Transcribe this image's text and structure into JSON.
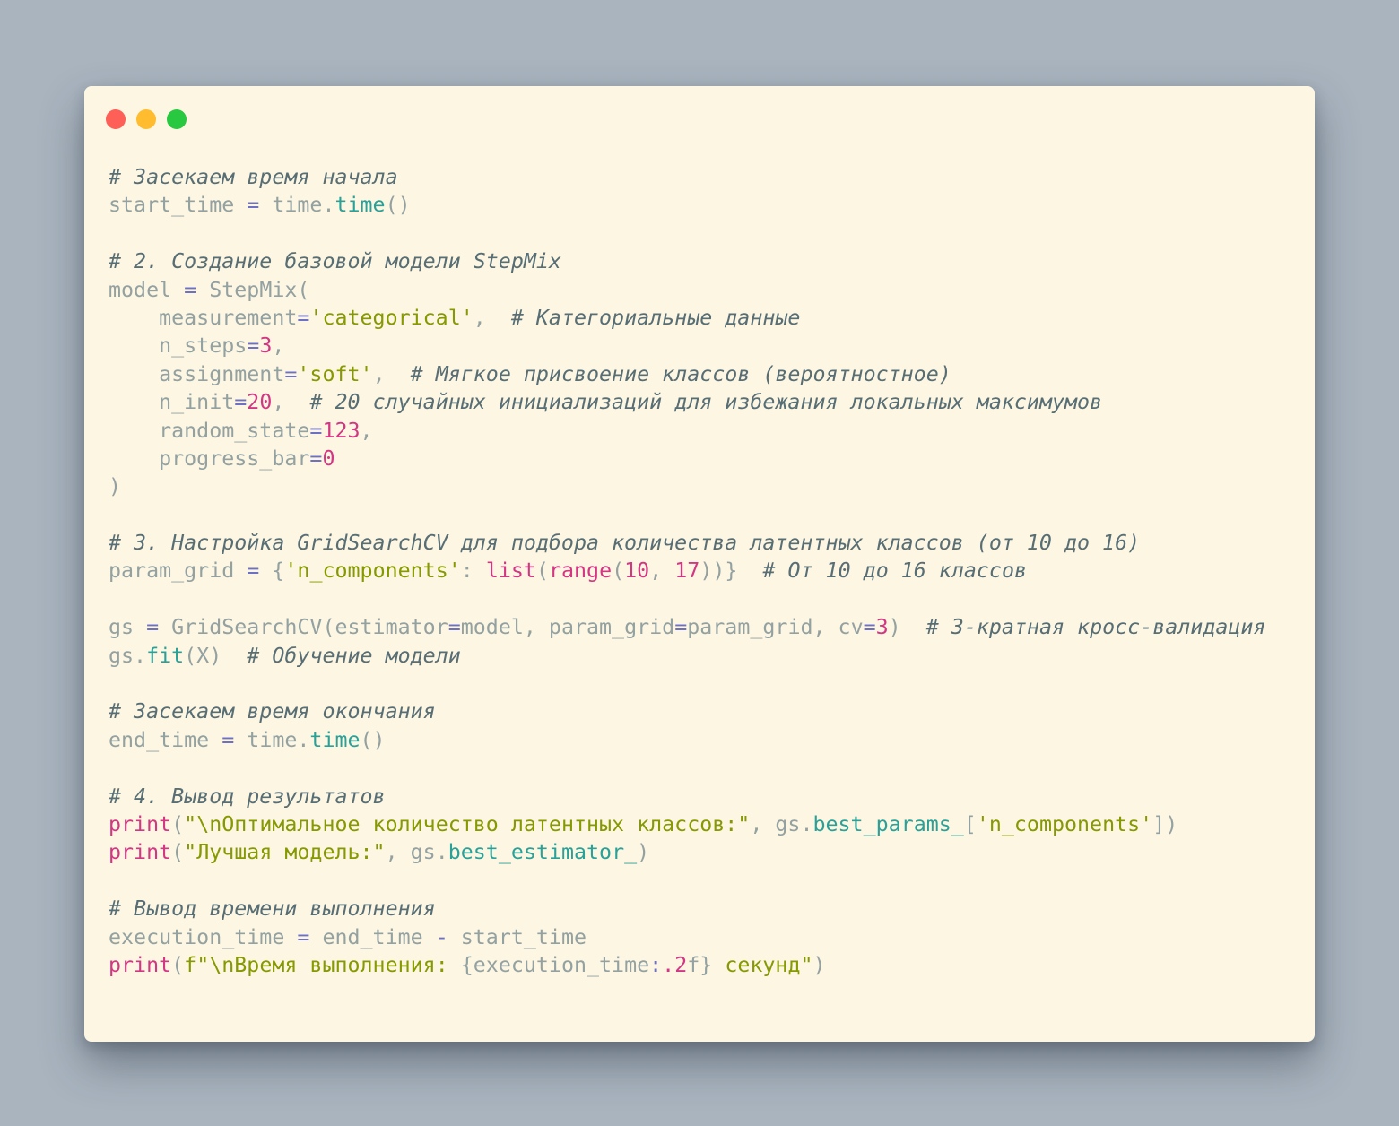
{
  "window": {
    "control_colors": [
      "#fe5f57",
      "#febc2e",
      "#28c840"
    ]
  },
  "code": {
    "lines": [
      [
        {
          "t": "# Засекаем время начала",
          "c": "cm"
        }
      ],
      [
        {
          "t": "start_time ",
          "c": "df"
        },
        {
          "t": "=",
          "c": "op"
        },
        {
          "t": " time.",
          "c": "df"
        },
        {
          "t": "time",
          "c": "fn"
        },
        {
          "t": "()",
          "c": "df"
        }
      ],
      [],
      [
        {
          "t": "# 2. Создание базовой модели StepMix",
          "c": "cm"
        }
      ],
      [
        {
          "t": "model ",
          "c": "df"
        },
        {
          "t": "=",
          "c": "op"
        },
        {
          "t": " StepMix(",
          "c": "df"
        }
      ],
      [
        {
          "t": "    measurement",
          "c": "df"
        },
        {
          "t": "=",
          "c": "op"
        },
        {
          "t": "'categorical'",
          "c": "str"
        },
        {
          "t": ",  ",
          "c": "df"
        },
        {
          "t": "# Категориальные данные",
          "c": "cm"
        }
      ],
      [
        {
          "t": "    n_steps",
          "c": "df"
        },
        {
          "t": "=",
          "c": "op"
        },
        {
          "t": "3",
          "c": "num"
        },
        {
          "t": ",",
          "c": "df"
        }
      ],
      [
        {
          "t": "    assignment",
          "c": "df"
        },
        {
          "t": "=",
          "c": "op"
        },
        {
          "t": "'soft'",
          "c": "str"
        },
        {
          "t": ",  ",
          "c": "df"
        },
        {
          "t": "# Мягкое присвоение классов (вероятностное)",
          "c": "cm"
        }
      ],
      [
        {
          "t": "    n_init",
          "c": "df"
        },
        {
          "t": "=",
          "c": "op"
        },
        {
          "t": "20",
          "c": "num"
        },
        {
          "t": ",  ",
          "c": "df"
        },
        {
          "t": "# 20 случайных инициализаций для избежания локальных максимумов",
          "c": "cm"
        }
      ],
      [
        {
          "t": "    random_state",
          "c": "df"
        },
        {
          "t": "=",
          "c": "op"
        },
        {
          "t": "123",
          "c": "num"
        },
        {
          "t": ",",
          "c": "df"
        }
      ],
      [
        {
          "t": "    progress_bar",
          "c": "df"
        },
        {
          "t": "=",
          "c": "op"
        },
        {
          "t": "0",
          "c": "num"
        }
      ],
      [
        {
          "t": ")",
          "c": "df"
        }
      ],
      [],
      [
        {
          "t": "# 3. Настройка GridSearchCV для подбора количества латентных классов (от 10 до 16)",
          "c": "cm"
        }
      ],
      [
        {
          "t": "param_grid ",
          "c": "df"
        },
        {
          "t": "=",
          "c": "op"
        },
        {
          "t": " {",
          "c": "df"
        },
        {
          "t": "'n_components'",
          "c": "str"
        },
        {
          "t": ": ",
          "c": "df"
        },
        {
          "t": "list",
          "c": "bi"
        },
        {
          "t": "(",
          "c": "df"
        },
        {
          "t": "range",
          "c": "bi"
        },
        {
          "t": "(",
          "c": "df"
        },
        {
          "t": "10",
          "c": "num"
        },
        {
          "t": ", ",
          "c": "df"
        },
        {
          "t": "17",
          "c": "num"
        },
        {
          "t": "))}  ",
          "c": "df"
        },
        {
          "t": "# От 10 до 16 классов",
          "c": "cm"
        }
      ],
      [],
      [
        {
          "t": "gs ",
          "c": "df"
        },
        {
          "t": "=",
          "c": "op"
        },
        {
          "t": " GridSearchCV(estimator",
          "c": "df"
        },
        {
          "t": "=",
          "c": "op"
        },
        {
          "t": "model, param_grid",
          "c": "df"
        },
        {
          "t": "=",
          "c": "op"
        },
        {
          "t": "param_grid, cv",
          "c": "df"
        },
        {
          "t": "=",
          "c": "op"
        },
        {
          "t": "3",
          "c": "num"
        },
        {
          "t": ")  ",
          "c": "df"
        },
        {
          "t": "# 3-кратная кросс-валидация",
          "c": "cm"
        }
      ],
      [
        {
          "t": "gs.",
          "c": "df"
        },
        {
          "t": "fit",
          "c": "fn"
        },
        {
          "t": "(X)  ",
          "c": "df"
        },
        {
          "t": "# Обучение модели",
          "c": "cm"
        }
      ],
      [],
      [
        {
          "t": "# Засекаем время окончания",
          "c": "cm"
        }
      ],
      [
        {
          "t": "end_time ",
          "c": "df"
        },
        {
          "t": "=",
          "c": "op"
        },
        {
          "t": " time.",
          "c": "df"
        },
        {
          "t": "time",
          "c": "fn"
        },
        {
          "t": "()",
          "c": "df"
        }
      ],
      [],
      [
        {
          "t": "# 4. Вывод результатов",
          "c": "cm"
        }
      ],
      [
        {
          "t": "print",
          "c": "bi"
        },
        {
          "t": "(",
          "c": "df"
        },
        {
          "t": "\"\\nОптимальное количество латентных классов:\"",
          "c": "str"
        },
        {
          "t": ", gs.",
          "c": "df"
        },
        {
          "t": "best_params_",
          "c": "fn"
        },
        {
          "t": "[",
          "c": "df"
        },
        {
          "t": "'n_components'",
          "c": "str"
        },
        {
          "t": "])",
          "c": "df"
        }
      ],
      [
        {
          "t": "print",
          "c": "bi"
        },
        {
          "t": "(",
          "c": "df"
        },
        {
          "t": "\"Лучшая модель:\"",
          "c": "str"
        },
        {
          "t": ", gs.",
          "c": "df"
        },
        {
          "t": "best_estimator_",
          "c": "fn"
        },
        {
          "t": ")",
          "c": "df"
        }
      ],
      [],
      [
        {
          "t": "# Вывод времени выполнения",
          "c": "cm"
        }
      ],
      [
        {
          "t": "execution_time ",
          "c": "df"
        },
        {
          "t": "=",
          "c": "op"
        },
        {
          "t": " end_time ",
          "c": "df"
        },
        {
          "t": "-",
          "c": "op"
        },
        {
          "t": " start_time",
          "c": "df"
        }
      ],
      [
        {
          "t": "print",
          "c": "bi"
        },
        {
          "t": "(",
          "c": "df"
        },
        {
          "t": "f\"\\nВремя выполнения: ",
          "c": "str"
        },
        {
          "t": "{execution_time",
          "c": "df"
        },
        {
          "t": ":",
          "c": "op"
        },
        {
          "t": ".2",
          "c": "num"
        },
        {
          "t": "f}",
          "c": "df"
        },
        {
          "t": " секунд\"",
          "c": "str"
        },
        {
          "t": ")",
          "c": "df"
        }
      ]
    ]
  }
}
